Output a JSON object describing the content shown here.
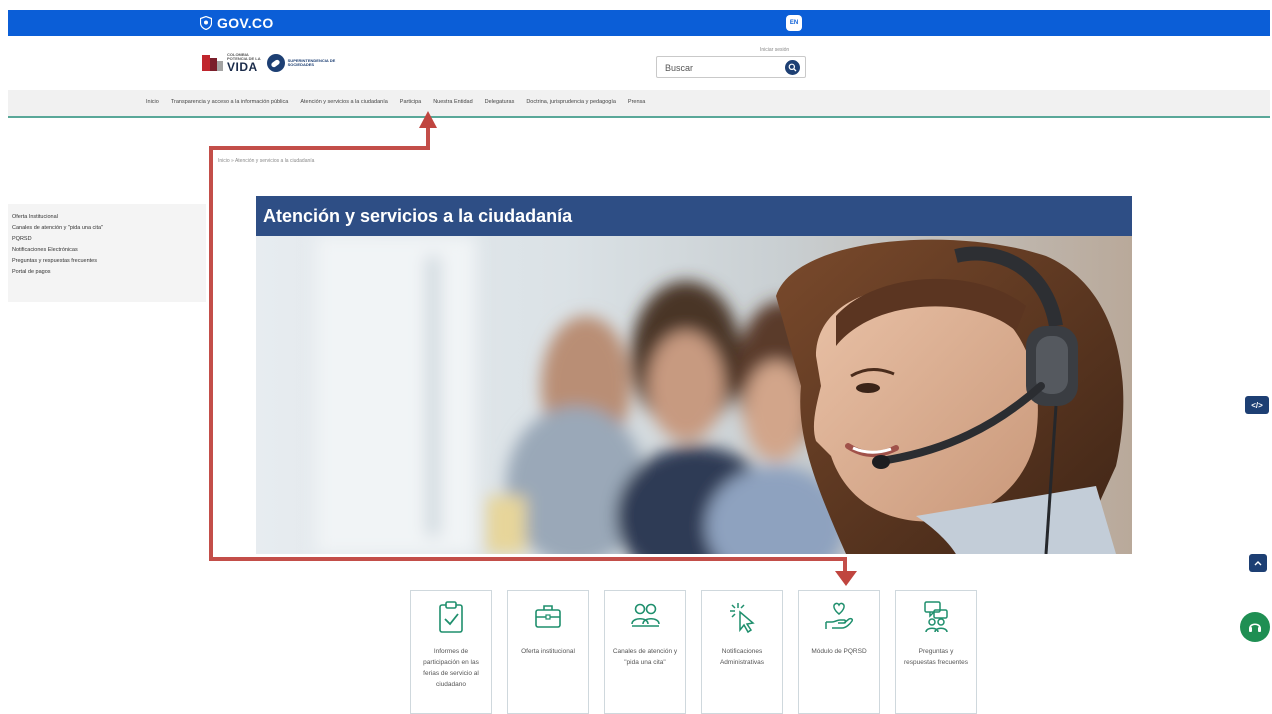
{
  "govbar": {
    "logo_text": "GOV.CO",
    "lang_label": "EN",
    "bar_color": "#0b5ed7"
  },
  "header": {
    "brand_colombia_top": "COLOMBIA",
    "brand_colombia_mid": "POTENCIA DE LA",
    "brand_colombia_main": "VIDA",
    "brand_supersoc": "SUPERINTENDENCIA DE SOCIEDADES",
    "login_label": "Iniciar sesión",
    "search_placeholder": "Buscar"
  },
  "nav": {
    "items": [
      {
        "label": "Inicio"
      },
      {
        "label": "Transparencia y acceso a la información pública"
      },
      {
        "label": "Atención y servicios a la ciudadanía"
      },
      {
        "label": "Participa"
      },
      {
        "label": "Nuestra Entidad"
      },
      {
        "label": "Delegaturas"
      },
      {
        "label": "Doctrina, jurisprudencia y pedagogía"
      },
      {
        "label": "Prensa"
      }
    ]
  },
  "breadcrumb": "Inicio » Atención y servicios a la ciudadanía",
  "sidebar": {
    "items": [
      {
        "label": "Oferta Institucional"
      },
      {
        "label": "Canales de atención y \"pida una cita\""
      },
      {
        "label": "PQRSD"
      },
      {
        "label": "Notificaciones Electrónicas"
      },
      {
        "label": "Preguntas y respuestas frecuentes"
      },
      {
        "label": "Portal de pagos"
      }
    ]
  },
  "hero": {
    "title": "Atención y servicios a la ciudadanía",
    "title_bg": "#2e4e85"
  },
  "cards": [
    {
      "label": "Informes de participación en las ferias de servicio al ciudadano",
      "icon": "clipboard-check-icon"
    },
    {
      "label": "Oferta institucional",
      "icon": "briefcase-icon"
    },
    {
      "label": "Canales de atención y \"pida una cita\"",
      "icon": "people-icon"
    },
    {
      "label": "Notificaciones Administrativas",
      "icon": "pointer-click-icon"
    },
    {
      "label": "Módulo de PQRSD",
      "icon": "hand-heart-icon"
    },
    {
      "label": "Preguntas y respuestas frecuentes",
      "icon": "chat-people-icon"
    }
  ],
  "floating": {
    "embed_label": "</>",
    "accent": "#1d3f73",
    "help_color": "#1f8f53"
  },
  "annotation_color": "#c0453f"
}
